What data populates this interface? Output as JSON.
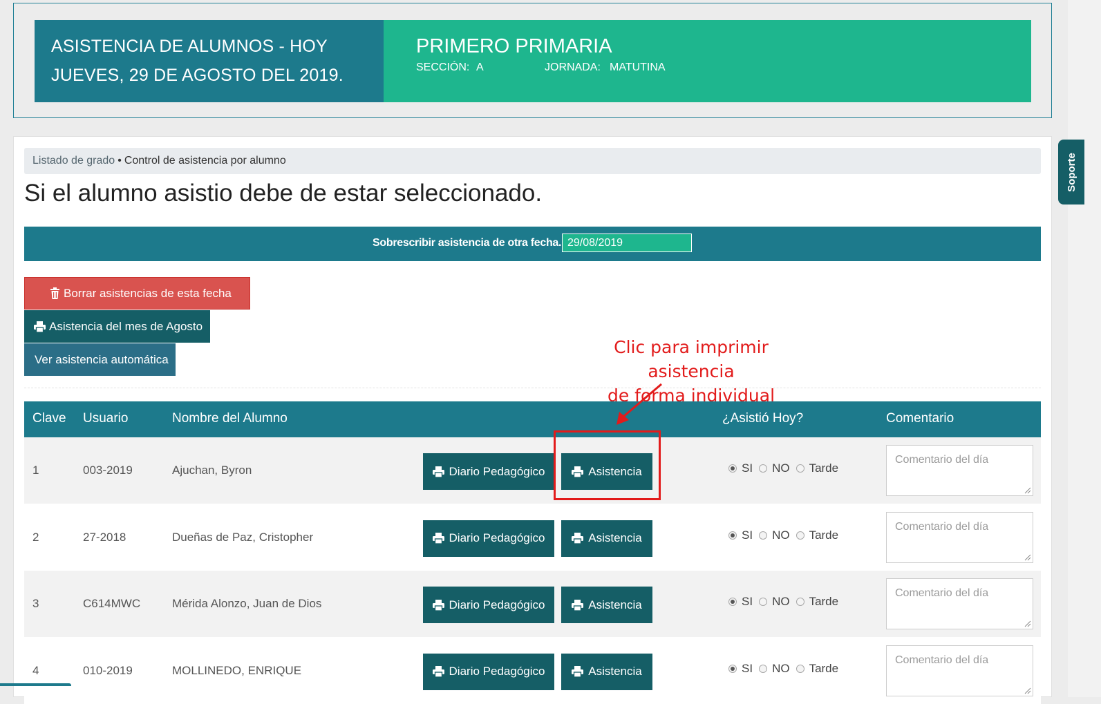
{
  "banner": {
    "title_line1": "ASISTENCIA DE ALUMNOS - HOY",
    "title_line2": "JUEVES, 29 DE AGOSTO DEL 2019.",
    "grade": "PRIMERO PRIMARIA",
    "section_label": "SECCIÓN:",
    "section_value": "A",
    "shift_label": "JORNADA:",
    "shift_value": "MATUTINA"
  },
  "support_tab": "Soporte",
  "breadcrumb": {
    "link": "Listado de grado",
    "separator": "•",
    "current": "Control de asistencia por alumno"
  },
  "headline": "Si el alumno asistio debe de estar seleccionado.",
  "date_override": {
    "label": "Sobrescribir asistencia de otra fecha.",
    "value": "29/08/2019"
  },
  "actions": {
    "delete_label": "Borrar asistencias de esta fecha",
    "month_label": "Asistencia del mes de Agosto",
    "auto_label": "Ver asistencia automática"
  },
  "annotation": {
    "line1": "Clic para imprimir asistencia",
    "line2": "de forma individual"
  },
  "table": {
    "headers": {
      "key": "Clave",
      "user": "Usuario",
      "name": "Nombre del Alumno",
      "attended": "¿Asistió Hoy?",
      "comment": "Comentario"
    },
    "diary_label": "Diario Pedagógico",
    "attendance_label": "Asistencia",
    "radio_yes": "SI",
    "radio_no": "NO",
    "radio_late": "Tarde",
    "comment_placeholder": "Comentario del día",
    "rows": [
      {
        "key": "1",
        "user": "003-2019",
        "name": "Ajuchan, Byron",
        "attended": "SI"
      },
      {
        "key": "2",
        "user": "27-2018",
        "name": "Dueñas de Paz, Cristopher",
        "attended": "SI"
      },
      {
        "key": "3",
        "user": "C614MWC",
        "name": "Mérida Alonzo, Juan de Dios",
        "attended": "SI"
      },
      {
        "key": "4",
        "user": "010-2019",
        "name": "MOLLINEDO, ENRIQUE",
        "attended": "SI"
      }
    ]
  },
  "colors": {
    "teal": "#1d7a8c",
    "green": "#1eb68e",
    "dark_teal": "#155e66",
    "danger": "#d9534f",
    "annotation": "#e21b1b"
  }
}
